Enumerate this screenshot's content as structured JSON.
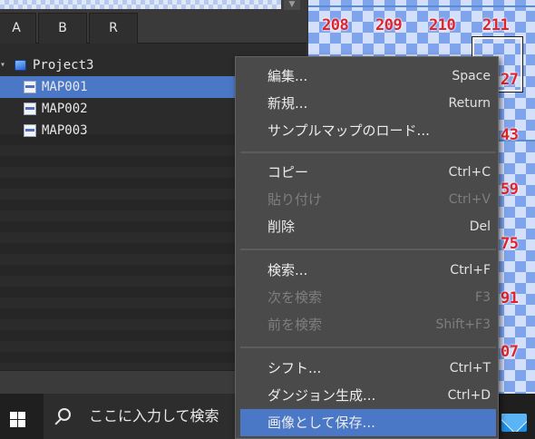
{
  "tabs": [
    {
      "label": "A"
    },
    {
      "label": "B"
    },
    {
      "label": "R"
    }
  ],
  "tree": {
    "project": {
      "label": "Project3",
      "expanded": true,
      "icon": "project-cube-icon"
    },
    "maps": [
      {
        "label": "MAP001",
        "selected": true,
        "icon": "map-icon"
      },
      {
        "label": "MAP002",
        "selected": false,
        "icon": "map-icon"
      },
      {
        "label": "MAP003",
        "selected": false,
        "icon": "map-icon"
      }
    ]
  },
  "map_editor": {
    "column_labels": [
      "208",
      "209",
      "210",
      "211"
    ],
    "row_label_fragments": [
      "27",
      "43",
      "59",
      "75",
      "91",
      "07"
    ]
  },
  "context_menu": {
    "groups": [
      [
        {
          "label": "編集...",
          "shortcut": "Space",
          "enabled": true
        },
        {
          "label": "新規...",
          "shortcut": "Return",
          "enabled": true
        },
        {
          "label": "サンプルマップのロード...",
          "shortcut": "",
          "enabled": true
        }
      ],
      [
        {
          "label": "コピー",
          "shortcut": "Ctrl+C",
          "enabled": true
        },
        {
          "label": "貼り付け",
          "shortcut": "Ctrl+V",
          "enabled": false
        },
        {
          "label": "削除",
          "shortcut": "Del",
          "enabled": true
        }
      ],
      [
        {
          "label": "検索...",
          "shortcut": "Ctrl+F",
          "enabled": true
        },
        {
          "label": "次を検索",
          "shortcut": "F3",
          "enabled": false
        },
        {
          "label": "前を検索",
          "shortcut": "Shift+F3",
          "enabled": false
        }
      ],
      [
        {
          "label": "シフト...",
          "shortcut": "Ctrl+T",
          "enabled": true
        },
        {
          "label": "ダンジョン生成...",
          "shortcut": "Ctrl+D",
          "enabled": true
        },
        {
          "label": "画像として保存...",
          "shortcut": "",
          "enabled": true,
          "highlighted": true
        }
      ]
    ]
  },
  "taskbar": {
    "search_placeholder": "ここに入力して検索",
    "start_icon": "windows-logo-icon",
    "tray_icon": "mail-icon"
  },
  "colors": {
    "selection": "#4a78c6",
    "panel": "#2b2b2b",
    "menu_bg": "#4a4a4a",
    "map_number": "#e0232d"
  }
}
